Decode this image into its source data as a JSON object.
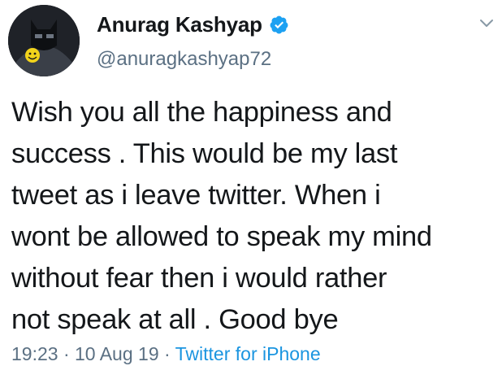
{
  "tweet": {
    "author": {
      "display_name": "Anurag Kashyap",
      "handle": "@anuragkashyap72",
      "verified": true
    },
    "text_lines": [
      "Wish you all the happiness and",
      "success . This would be my last",
      "tweet as i leave twitter. When i",
      "wont be allowed to speak my mind",
      "without fear then i would rather",
      "not speak at all . Good bye"
    ],
    "meta": {
      "time": "19:23",
      "separator": " · ",
      "date": "10 Aug 19",
      "source": "Twitter for iPhone"
    }
  },
  "icons": {
    "verified": "verified-badge-icon",
    "menu": "chevron-down-icon"
  },
  "colors": {
    "verified_blue": "#1da1f2",
    "link_blue": "#1b95e0",
    "secondary_text": "#5b7083",
    "primary_text": "#14171a"
  }
}
